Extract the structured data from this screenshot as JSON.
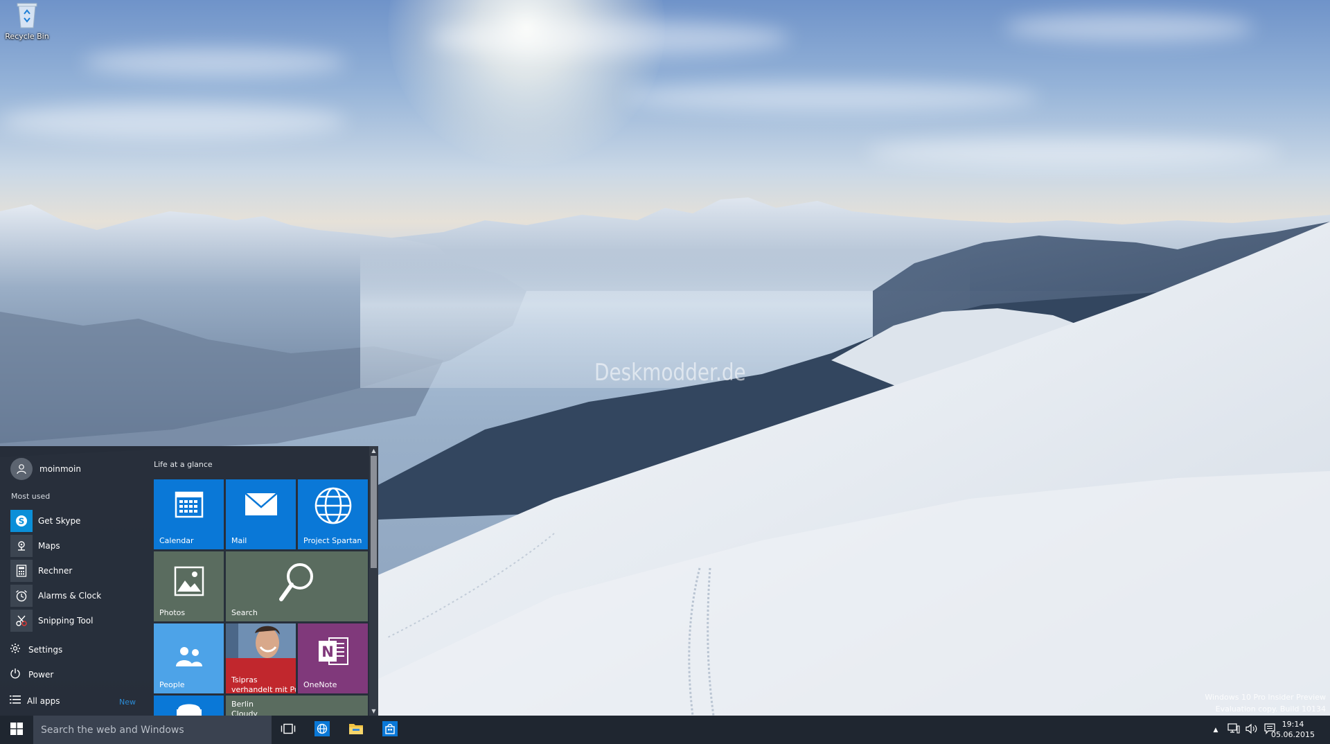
{
  "desktop": {
    "recycle_bin_label": "Recycle Bin",
    "watermark": "Deskmodder.de",
    "evaluation": {
      "line1": "Windows 10 Pro Insider Preview",
      "line2": "Evaluation copy. Build 10134"
    }
  },
  "start_menu": {
    "user_name": "moinmoin",
    "most_used_label": "Most used",
    "apps": [
      {
        "label": "Get Skype",
        "icon": "skype-icon"
      },
      {
        "label": "Maps",
        "icon": "maps-icon"
      },
      {
        "label": "Rechner",
        "icon": "calculator-icon"
      },
      {
        "label": "Alarms & Clock",
        "icon": "alarm-clock-icon"
      },
      {
        "label": "Snipping Tool",
        "icon": "scissors-icon"
      }
    ],
    "settings_label": "Settings",
    "power_label": "Power",
    "all_apps_label": "All apps",
    "all_apps_badge": "New",
    "tiles_group_title": "Life at a glance",
    "tiles": {
      "calendar": "Calendar",
      "mail": "Mail",
      "spartan": "Project Spartan",
      "photos": "Photos",
      "search": "Search",
      "people": "People",
      "news_line1": "Tsipras",
      "news_line2": "verhandelt mit Pu",
      "onenote": "OneNote",
      "weather_line1": "Berlin",
      "weather_line2": "Cloudy"
    }
  },
  "taskbar": {
    "search_placeholder": "Search the web and Windows",
    "time": "19:14",
    "date": "05.06.2015"
  },
  "colors": {
    "accent": "#0a78d7",
    "taskbar": "#1f2630",
    "start_bg": "#1f2630",
    "search_tile": "#5a6c5f",
    "people_tile": "#4da3e8",
    "onenote_tile": "#80397b",
    "news_tile": "#c1272d"
  }
}
